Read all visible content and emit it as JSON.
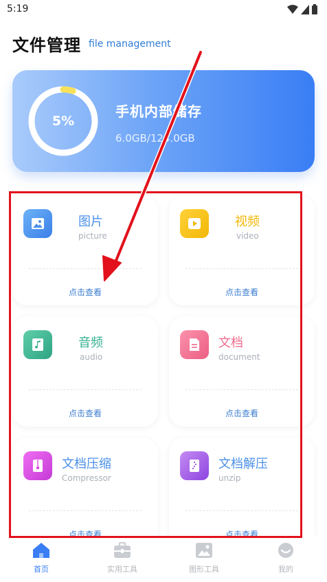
{
  "status_bar": {
    "time": "5:19"
  },
  "header": {
    "title": "文件管理",
    "subtitle": "file management"
  },
  "storage": {
    "percent_label": "5%",
    "used_fraction": 0.05,
    "title": "手机内部储存",
    "usage": "6.0GB/124.0GB"
  },
  "categories": [
    {
      "name": "图片",
      "en": "picture",
      "action": "点击查看",
      "color": "#4b90e8",
      "icon": "image-icon"
    },
    {
      "name": "视频",
      "en": "video",
      "action": "点击查看",
      "color": "#f2b705",
      "icon": "play-icon"
    },
    {
      "name": "音频",
      "en": "audio",
      "action": "点击查看",
      "color": "#35b18f",
      "icon": "music-note-icon"
    },
    {
      "name": "文档",
      "en": "document",
      "action": "点击查看",
      "color": "#f06c8e",
      "icon": "document-icon"
    },
    {
      "name": "文档压缩",
      "en": "Compressor",
      "action": "点击查看",
      "color": "#d94be0",
      "icon": "zip-icon"
    },
    {
      "name": "文档解压",
      "en": "unzip",
      "action": "点击查看",
      "color": "#a45ee6",
      "icon": "unzip-icon"
    }
  ],
  "nav": {
    "items": [
      {
        "label": "首页",
        "icon": "home-icon",
        "active": true
      },
      {
        "label": "实用工具",
        "icon": "toolbox-icon",
        "active": false
      },
      {
        "label": "图形工具",
        "icon": "picture-icon",
        "active": false
      },
      {
        "label": "我的",
        "icon": "profile-icon",
        "active": false
      }
    ]
  },
  "colors": {
    "accent": "#3a7ef5",
    "annotation": "#e2111b"
  }
}
